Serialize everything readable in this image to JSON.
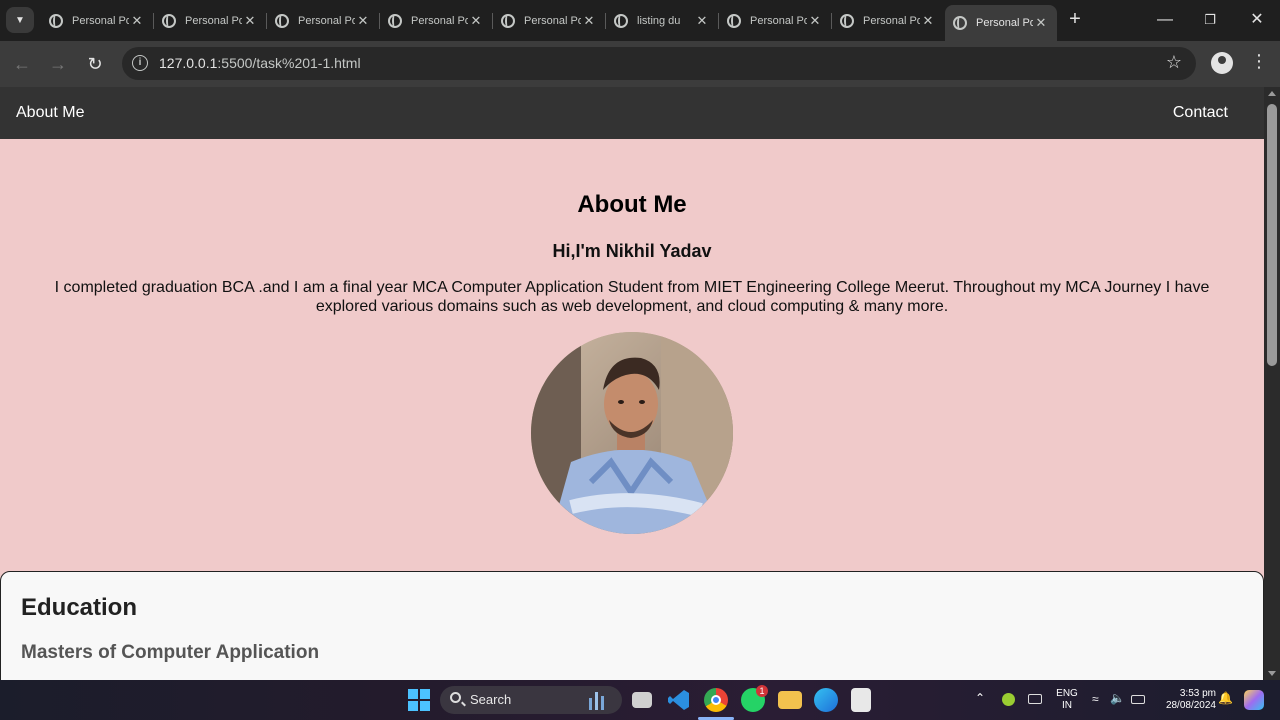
{
  "browser": {
    "tabs": [
      {
        "title": "Personal Portfolio",
        "active": false
      },
      {
        "title": "Personal Portfolio",
        "active": false
      },
      {
        "title": "Personal Portfolio",
        "active": false
      },
      {
        "title": "Personal Portfolio",
        "active": false
      },
      {
        "title": "Personal Portfolio",
        "active": false
      },
      {
        "title": "listing du",
        "active": false
      },
      {
        "title": "Personal Portfolio",
        "active": false
      },
      {
        "title": "Personal Portfolio",
        "active": false
      },
      {
        "title": "Personal Portfolio",
        "active": true
      }
    ],
    "url_host": "127.0.0.1",
    "url_path": ":5500/task%201-1.html"
  },
  "site": {
    "nav": {
      "left": "About Me",
      "right": "Contact"
    },
    "about": {
      "heading": "About Me",
      "greeting": "Hi,I'm Nikhil Yadav",
      "bio": "I completed graduation BCA .and I am a final year MCA Computer Application Student from MIET Engineering College Meerut. Throughout my MCA Journey I have explored various domains such as web development, and cloud computing & many more."
    },
    "education": {
      "heading": "Education",
      "degree": "Masters of Computer Application"
    }
  },
  "taskbar": {
    "search_label": "Search",
    "whatsapp_badge": "1",
    "lang_top": "ENG",
    "lang_bottom": "IN",
    "time": "3:53 pm",
    "date": "28/08/2024"
  }
}
